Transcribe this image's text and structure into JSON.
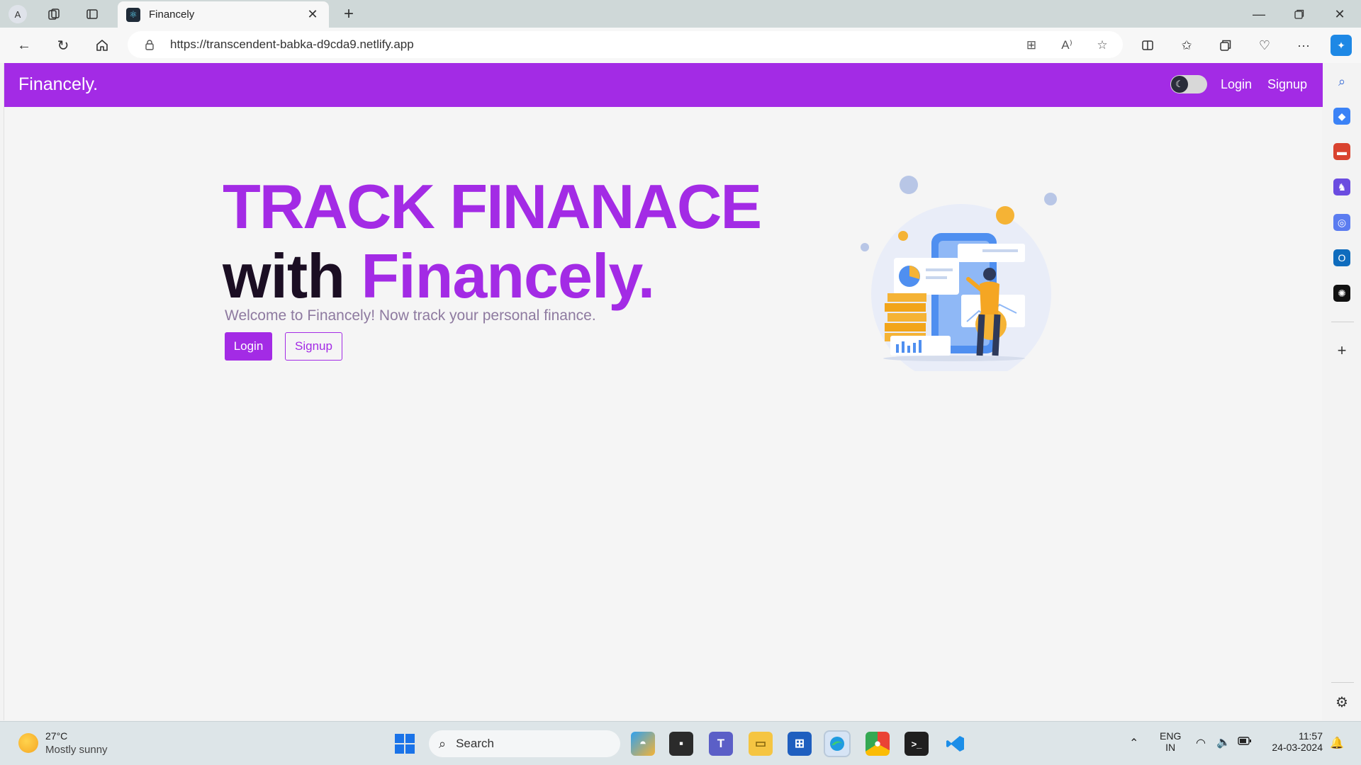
{
  "browser": {
    "profile_initial": "A",
    "tab": {
      "title": "Financely",
      "favicon": "react-icon"
    },
    "new_tab_glyph": "+",
    "address": {
      "url": "https://transcendent-babka-d9cda9.netlify.app"
    }
  },
  "app": {
    "brand": "Financely.",
    "nav": {
      "login": "Login",
      "signup": "Signup"
    },
    "theme_toggle": {
      "state": "dark-mode-icon"
    },
    "hero": {
      "title_line1": "TRACK FINANACE",
      "title_line2_prefix": "with ",
      "title_line2_accent": "Financely.",
      "subtitle": "Welcome to Financely! Now track your personal finance.",
      "login_label": "Login",
      "signup_label": "Signup"
    },
    "colors": {
      "accent": "#a32be5",
      "dark_text": "#1b0e23",
      "subtitle": "#8e7aa0"
    }
  },
  "taskbar": {
    "weather": {
      "temp": "27°C",
      "desc": "Mostly sunny"
    },
    "search_label": "Search",
    "language": {
      "line1": "ENG",
      "line2": "IN"
    },
    "clock": {
      "time": "11:57",
      "date": "24-03-2024"
    }
  }
}
